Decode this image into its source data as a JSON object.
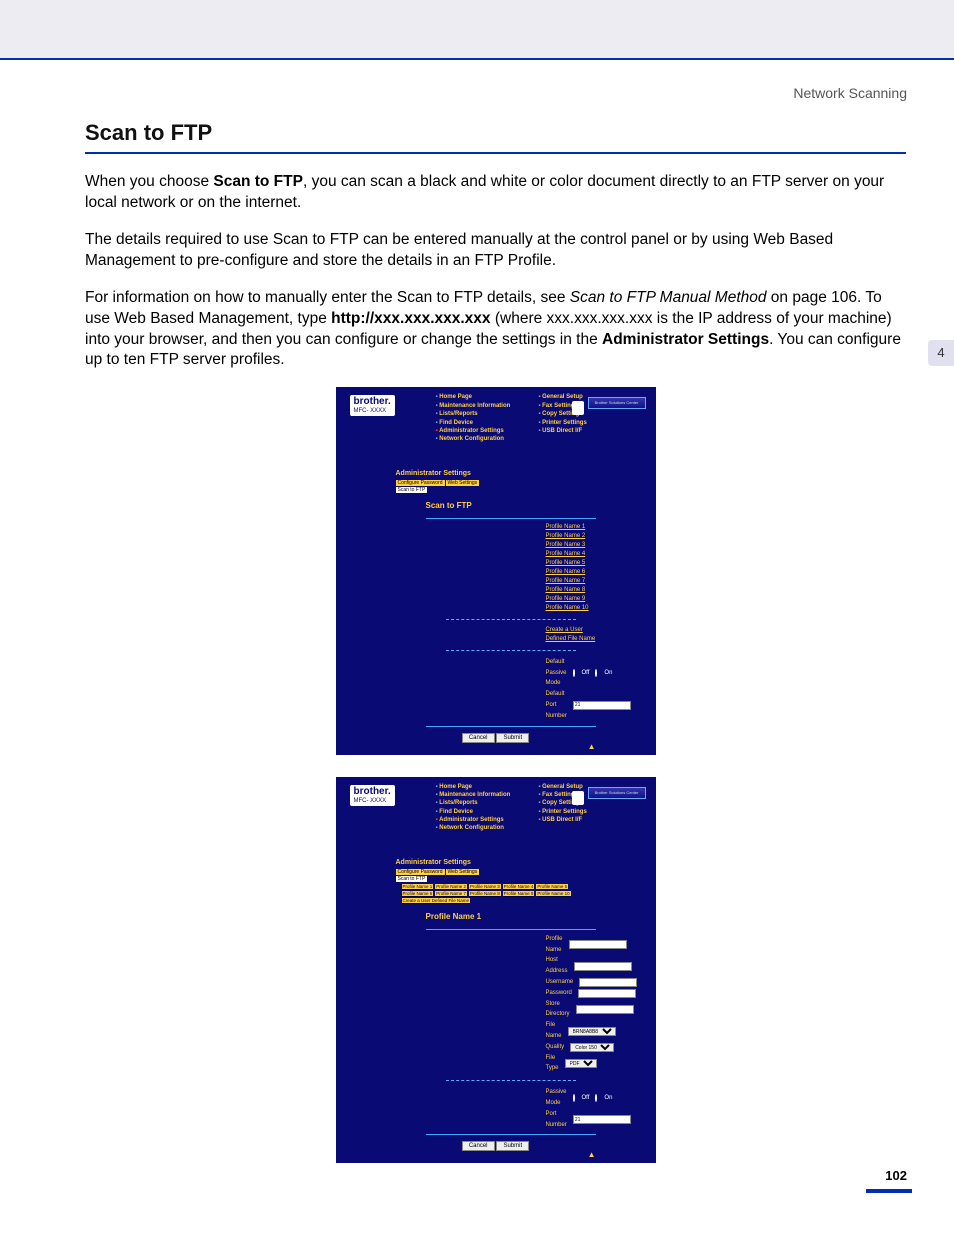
{
  "header": "Network Scanning",
  "title": "Scan to FTP",
  "section_tab": "4",
  "page_number": "102",
  "para1_a": "When you choose ",
  "para1_b": "Scan to FTP",
  "para1_c": ", you can scan a black and white or color document directly to an FTP server on your local network or on the internet.",
  "para2": "The details required to use Scan to FTP can be entered manually at the control panel or by using Web Based Management to pre-configure and store the details in an FTP Profile.",
  "para3_a": "For information on how to manually enter the Scan to FTP details, see ",
  "para3_b": "Scan to FTP Manual Method",
  "para3_c": " on page 106. To use Web Based Management, type ",
  "para3_d": "http://xxx.xxx.xxx.xxx",
  "para3_e": " (where xxx.xxx.xxx.xxx is the IP address of your machine) into your browser, and then you can configure or change the settings in the ",
  "para3_f": "Administrator Settings",
  "para3_g": ". You can configure up to ten FTP server profiles.",
  "brother": {
    "logo": "brother.",
    "model": "MFC- XXXX",
    "solutions": "Brother Solutions Center",
    "nav_col1": [
      "Home Page",
      "Maintenance Information",
      "Lists/Reports",
      "Find Device",
      "Administrator Settings",
      "Network Configuration"
    ],
    "nav_col2": [
      "General Setup",
      "Fax Settings",
      "Copy Settings",
      "Printer Settings",
      "USB Direct I/F"
    ],
    "admin_settings": "Administrator Settings",
    "crumb_configure": "Configure Password",
    "crumb_web": "Web Settings",
    "crumb_scan": "Scan to FTP",
    "box_title": "Scan to FTP",
    "profiles": [
      "Profile Name 1",
      "Profile Name 2",
      "Profile Name 3",
      "Profile Name 4",
      "Profile Name 5",
      "Profile Name 6",
      "Profile Name 7",
      "Profile Name 8",
      "Profile Name 9",
      "Profile Name 10"
    ],
    "create_file": "Create a User Defined File Name",
    "passive_mode": "Default Passive Mode",
    "port_number": "Default Port Number",
    "port_value": "21",
    "radio_off": "Off",
    "radio_on": "On",
    "cancel": "Cancel",
    "submit": "Submit"
  },
  "detail": {
    "title": "Profile Name 1",
    "profile_tabs": [
      "Profile Name 1",
      "Profile Name 2",
      "Profile Name 3",
      "Profile Name 4",
      "Profile Name 5",
      "Profile Name 6",
      "Profile Name 7",
      "Profile Name 8",
      "Profile Name 9",
      "Profile Name 10"
    ],
    "rows": {
      "profile_name": "Profile Name",
      "host": "Host Address",
      "user": "Username",
      "pass": "Password",
      "store": "Store Directory",
      "file": "File Name",
      "file_val": "BRN8A8B8",
      "quality": "Quality",
      "quality_val": "Color 150",
      "type": "File Type",
      "type_val": "PDF",
      "passive": "Passive Mode",
      "port": "Port Number",
      "port_val": "21"
    }
  }
}
